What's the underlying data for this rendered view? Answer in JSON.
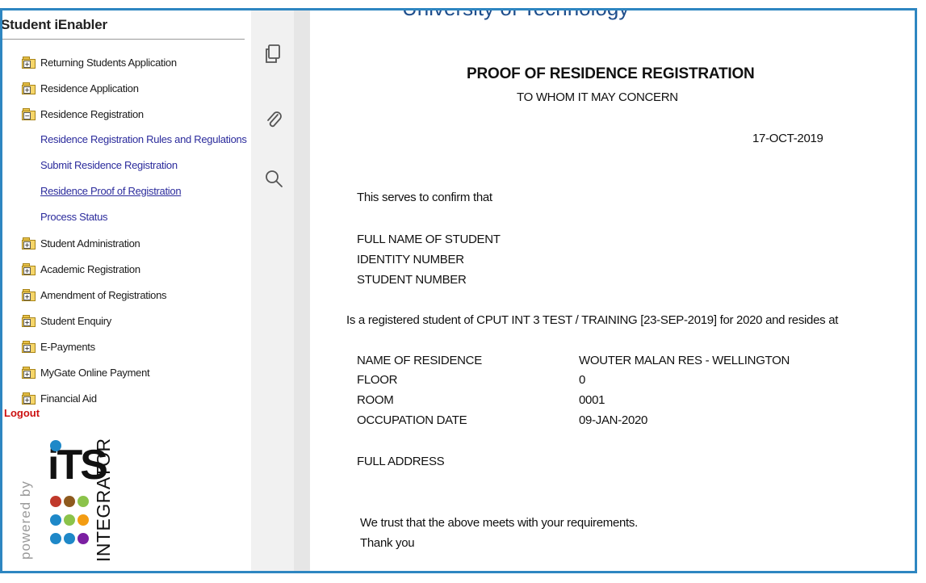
{
  "sidebar": {
    "title": "Student iEnabler",
    "items": [
      {
        "label": "Returning Students Application",
        "sign": "+"
      },
      {
        "label": "Residence Application",
        "sign": "+"
      },
      {
        "label": "Residence Registration",
        "sign": "−"
      }
    ],
    "subitems": [
      {
        "label": "Residence Registration Rules and Regulations"
      },
      {
        "label": "Submit Residence Registration"
      },
      {
        "label": "Residence Proof of Registration"
      },
      {
        "label": "Process Status"
      }
    ],
    "items_after": [
      {
        "label": "Student Administration",
        "sign": "+"
      },
      {
        "label": "Academic Registration",
        "sign": "+"
      },
      {
        "label": "Amendment of Registrations",
        "sign": "+"
      },
      {
        "label": "Student Enquiry",
        "sign": "+"
      },
      {
        "label": "E-Payments",
        "sign": "+"
      },
      {
        "label": "MyGate Online Payment",
        "sign": "+"
      },
      {
        "label": "Financial Aid",
        "sign": "+"
      }
    ],
    "logout": "Logout"
  },
  "logo": {
    "powered_by": "powered by",
    "brand": "iTS",
    "product": "INTEGRATOR",
    "dot_colors": [
      "#1e88c8",
      "#c0392b",
      "#8e5a1e",
      "#8bc34a",
      "#1e88c8",
      "#8bc34a",
      "#f39c12",
      "#1e88c8",
      "#1e88c8",
      "#7b1fa2",
      "#f1c40f"
    ]
  },
  "toolbar": {
    "tools": [
      "copy-icon",
      "paperclip-icon",
      "search-icon"
    ],
    "collapse": "chevron-left-icon"
  },
  "document": {
    "university": "University of Technology",
    "title": "PROOF OF RESIDENCE REGISTRATION",
    "subtitle": "TO WHOM IT MAY CONCERN",
    "date": "17-OCT-2019",
    "intro": "This serves to confirm that",
    "labels1": {
      "full_name": "FULL NAME OF STUDENT",
      "identity": "IDENTITY NUMBER",
      "student": "STUDENT NUMBER"
    },
    "statement": "Is a registered student of CPUT INT 3 TEST / TRAINING [23-SEP-2019] for 2020 and resides at",
    "residence": {
      "name_label": "NAME OF RESIDENCE",
      "name_value": "WOUTER MALAN RES - WELLINGTON",
      "floor_label": "FLOOR",
      "floor_value": "0",
      "room_label": "ROOM",
      "room_value": "0001",
      "date_label": "OCCUPATION DATE",
      "date_value": "09-JAN-2020"
    },
    "address_label": "FULL ADDRESS",
    "closing1": "We trust that the above meets with your requirements.",
    "closing2": "Thank you"
  },
  "colors": {
    "frame": "#2e86c1",
    "link": "#2b2b9c",
    "logout": "#cc1111",
    "university": "#1f4e8c"
  }
}
